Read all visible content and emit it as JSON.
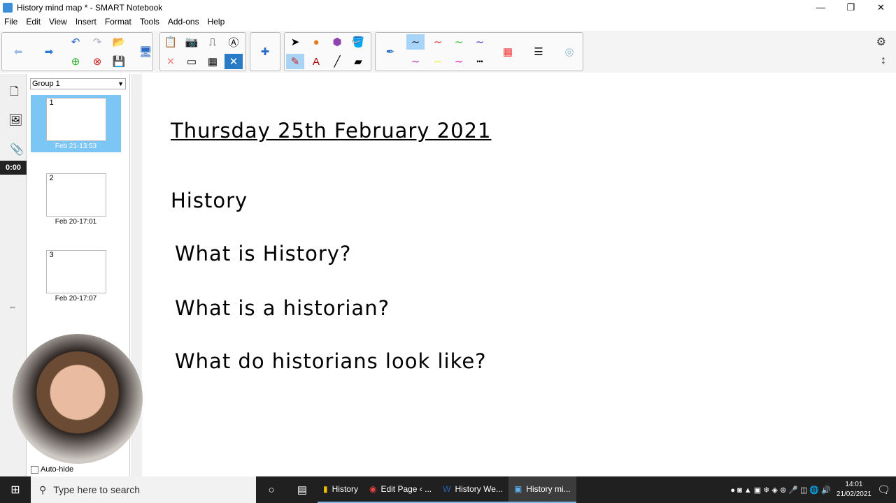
{
  "window": {
    "title": "History mind map * - SMART Notebook",
    "controls": [
      "—",
      "❐",
      "✕"
    ]
  },
  "menu": [
    "File",
    "Edit",
    "View",
    "Insert",
    "Format",
    "Tools",
    "Add-ons",
    "Help"
  ],
  "sorter": {
    "group": "Group 1",
    "pages": [
      {
        "num": "1",
        "date": "Feb 21-13:53"
      },
      {
        "num": "2",
        "date": "Feb 20-17:01"
      },
      {
        "num": "3",
        "date": "Feb 20-17:07"
      }
    ],
    "autohide": "Auto-hide"
  },
  "timer": "0:00",
  "page": {
    "date": "Thursday 25th February 2021",
    "heading": "History",
    "questions": [
      "What is History?",
      "What is a historian?",
      "What do historians look like?"
    ]
  },
  "taskbar": {
    "search_placeholder": "Type here to search",
    "tasks": [
      "History",
      "Edit Page ‹ ...",
      "History We...",
      "History mi..."
    ],
    "time": "14:01",
    "date": "21/02/2021"
  }
}
